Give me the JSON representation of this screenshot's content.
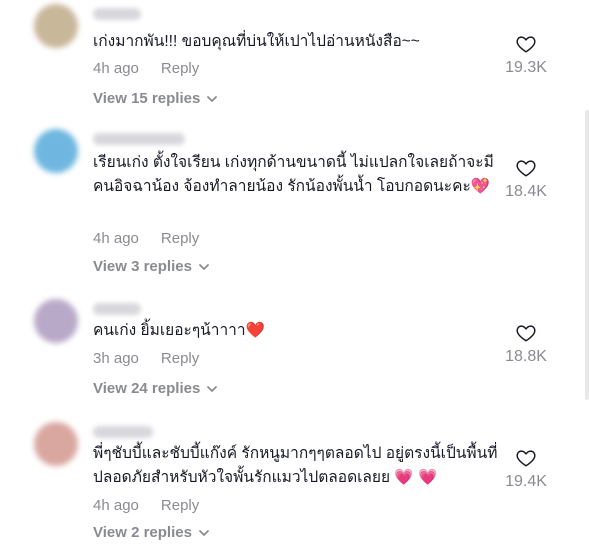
{
  "comments": [
    {
      "text": "เก่งมากพัน!!! ขอบคุณที่บ่นให้เปาไปอ่านหนังสือ~~",
      "time": "4h ago",
      "reply": "Reply",
      "likes": "19.3K",
      "view_replies": "View 15 replies",
      "avatar_color": "#c9b79a"
    },
    {
      "text": "เรียนเก่ง ตั้งใจเรียน เก่งทุกด้านขนาดนี้ ไม่แปลกใจเลยถ้าจะมีคนอิจฉาน้อง จ้องทำลายน้อง รักน้องพั้นน้ำ โอบกอดนะคะ💖",
      "time": "4h ago",
      "reply": "Reply",
      "likes": "18.4K",
      "view_replies": "View 3 replies",
      "avatar_color": "#6fb7e0"
    },
    {
      "text": "คนเก่ง ยิ้มเยอะๆน้าาาา❤️",
      "time": "3h ago",
      "reply": "Reply",
      "likes": "18.8K",
      "view_replies": "View 24 replies",
      "avatar_color": "#b9a9c8"
    },
    {
      "text": "พี่ๆชับบี้และชับบี้แก๊งค์ รักหนูมากๆๆตลอดไป อยู่ตรงนี้เป็นพื้นที่ปลอดภัยสำหรับหัวใจพั้นรักแมวไปตลอดเลยย 💗 💗",
      "time": "4h ago",
      "reply": "Reply",
      "likes": "19.4K",
      "view_replies": "View 2 replies",
      "avatar_color": "#d9a7a0"
    }
  ],
  "icons": {
    "like": "heart-outline-icon",
    "expand": "chevron-down-icon"
  }
}
